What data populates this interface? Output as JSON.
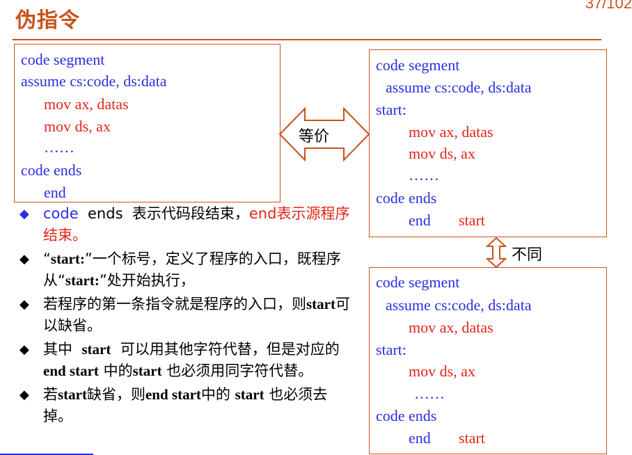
{
  "title": "伪指令",
  "page_number": "37/102",
  "left_box": [
    {
      "text": "code segment",
      "color": "blue"
    },
    {
      "text": "assume cs:code, ds:data",
      "color": "blue"
    },
    {
      "text": "mov ax, datas",
      "color": "red"
    },
    {
      "text": "mov ds, ax",
      "color": "red"
    },
    {
      "text": "……",
      "color": "blue"
    },
    {
      "text": "code ends",
      "color": "blue"
    },
    {
      "text": "end",
      "color": "blue"
    }
  ],
  "equiv_label": "等价",
  "diff_label": "不同",
  "right_top_box": {
    "line1": "code segment",
    "line2": "assume cs:code, ds:data",
    "line3": "start:",
    "line4": "mov ax, datas",
    "line5": "mov ds, ax",
    "line6": "……",
    "line7": "code ends",
    "line8a": "end",
    "line8b": "start"
  },
  "right_bottom_box": {
    "line1": "code segment",
    "line2": "assume cs:code, ds:data",
    "line3": "mov ax, datas",
    "line4": "start:",
    "line5": "mov ds, ax",
    "line6": "……",
    "line7": "code ends",
    "line8a": "end",
    "line8b": "start"
  },
  "bullets": {
    "b1_code": "code",
    "b1_ends": "ends",
    "b1_text": "表示代码段结束，",
    "b1_red": "end表示源程序结束。",
    "b2_q1": "“",
    "b2_start1": "start:",
    "b2_q2": "”",
    "b2_text1": "一个标号，定义了程序的入口，既程序从",
    "b2_q3": "“",
    "b2_start2": "start:",
    "b2_q4": "”",
    "b2_text2": "处开始执行，",
    "b3_text1": "若程序的第一条指令就是程序的入口，则",
    "b3_start": "start",
    "b3_text2": "可以缺省。",
    "b4_text1": "其中",
    "b4_start1": "start",
    "b4_text2": "可以用其他字符代替，但是对应的",
    "b4_endstart": "end start",
    "b4_text3": "中的",
    "b4_start2": "start",
    "b4_text4": "也必须用同字符代替。",
    "b5_text1": "若",
    "b5_start1": "start",
    "b5_text2": "缺省，则",
    "b5_endstart": "end start",
    "b5_text3": "中的",
    "b5_start2": "start",
    "b5_text4": "也必须去掉。"
  },
  "colors": {
    "accent": "#c8521c",
    "blue": "#2a2ee0",
    "red": "#e0261a",
    "bullet_blue": "#2a2ee0"
  }
}
